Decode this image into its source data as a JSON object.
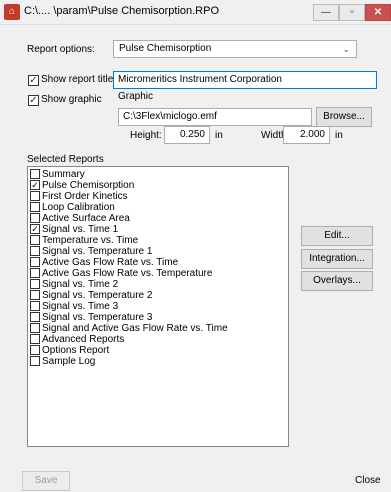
{
  "window": {
    "title": "C:\\....   \\param\\Pulse Chemisorption.RPO",
    "app_icon_glyph": "⌂",
    "minimize_glyph": "—",
    "maximize_glyph": "▫",
    "close_glyph": "✕"
  },
  "report_options": {
    "label": "Report options:",
    "selected": "Pulse Chemisorption"
  },
  "show_report_title": {
    "label": "Show report title",
    "checked": true,
    "value": "Micromeritics Instrument Corporation"
  },
  "show_graphic": {
    "label": "Show graphic",
    "checked": true
  },
  "graphic": {
    "label": "Graphic",
    "path": "C:\\3Flex\\miclogo.emf",
    "browse_label": "Browse...",
    "height_label": "Height:",
    "height_value": "0.250",
    "height_unit": "in",
    "width_label": "Width:",
    "width_value": "2.000",
    "width_unit": "in"
  },
  "selected_reports": {
    "label": "Selected Reports",
    "items": [
      {
        "label": "Summary",
        "checked": false
      },
      {
        "label": "Pulse Chemisorption",
        "checked": true
      },
      {
        "label": "First Order Kinetics",
        "checked": false
      },
      {
        "label": "Loop Calibration",
        "checked": false
      },
      {
        "label": "Active Surface Area",
        "checked": false
      },
      {
        "label": "Signal vs. Time 1",
        "checked": true
      },
      {
        "label": "Temperature vs. Time",
        "checked": false
      },
      {
        "label": "Signal vs. Temperature 1",
        "checked": false
      },
      {
        "label": "Active Gas Flow Rate vs. Time",
        "checked": false
      },
      {
        "label": "Active Gas Flow Rate vs. Temperature",
        "checked": false
      },
      {
        "label": "Signal vs. Time 2",
        "checked": false
      },
      {
        "label": "Signal vs. Temperature 2",
        "checked": false
      },
      {
        "label": "Signal vs. Time 3",
        "checked": false
      },
      {
        "label": "Signal vs. Temperature 3",
        "checked": false
      },
      {
        "label": "Signal and Active Gas Flow Rate vs. Time",
        "checked": false
      },
      {
        "label": "Advanced Reports",
        "checked": false
      },
      {
        "label": "Options Report",
        "checked": false
      },
      {
        "label": "Sample Log",
        "checked": false
      }
    ]
  },
  "side_buttons": {
    "edit": "Edit...",
    "integration": "Integration...",
    "overlays": "Overlays..."
  },
  "footer": {
    "save": "Save",
    "close": "Close"
  }
}
